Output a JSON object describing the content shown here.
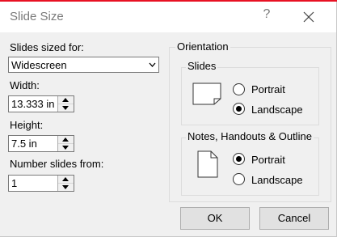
{
  "dialog": {
    "title": "Slide Size",
    "help_label": "?"
  },
  "slides_sized_for": {
    "label": "Slides sized for:",
    "value": "Widescreen"
  },
  "width": {
    "label": "Width:",
    "value": "13.333 in"
  },
  "height": {
    "label": "Height:",
    "value": "7.5 in"
  },
  "number_from": {
    "label": "Number slides from:",
    "value": "1"
  },
  "orientation": {
    "label": "Orientation",
    "slides": {
      "label": "Slides",
      "options": [
        {
          "label": "Portrait",
          "selected": false
        },
        {
          "label": "Landscape",
          "selected": true
        }
      ]
    },
    "notes": {
      "label": "Notes, Handouts & Outline",
      "options": [
        {
          "label": "Portrait",
          "selected": true
        },
        {
          "label": "Landscape",
          "selected": false
        }
      ]
    }
  },
  "buttons": {
    "ok": "OK",
    "cancel": "Cancel"
  },
  "colors": {
    "accent_line": "#e81123",
    "background": "#f0f0f0"
  }
}
